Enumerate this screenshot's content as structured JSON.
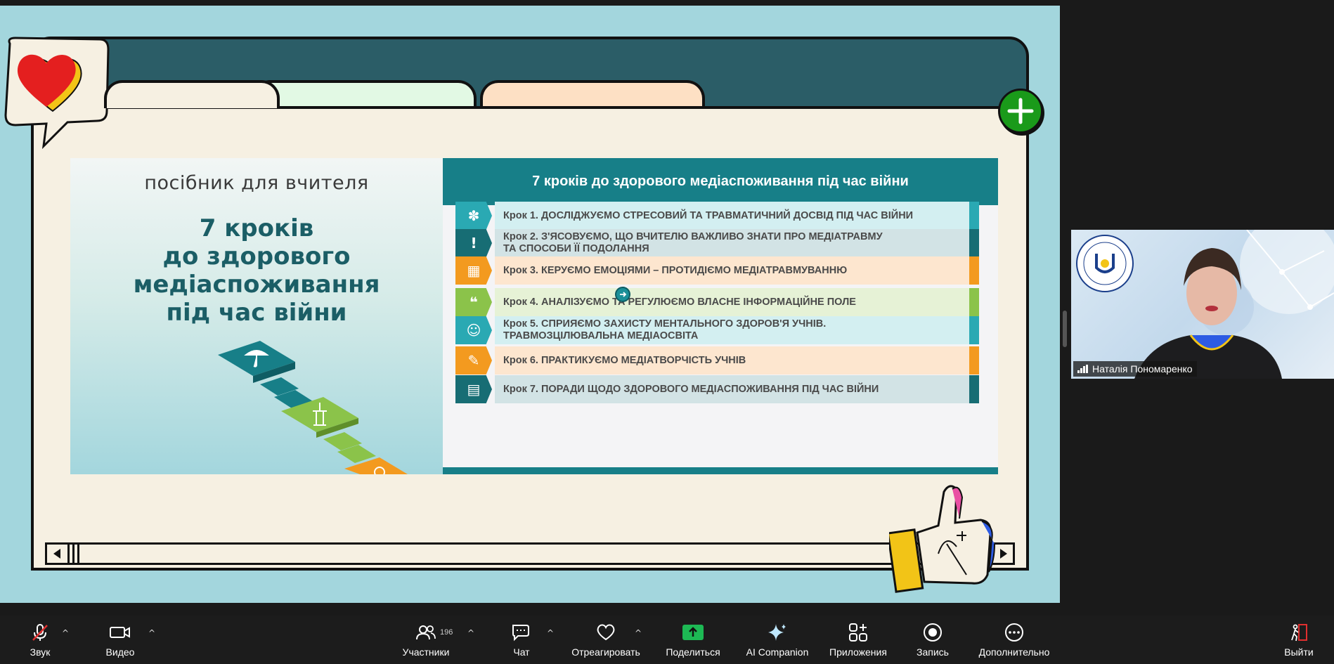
{
  "slide": {
    "guide_label": "посібник для вчителя",
    "guide_title": "7 кроків\nдо здорового\nмедіаспоживання\nпід час війни",
    "table_title": "7 кроків до здорового медіаспоживання під час війни",
    "steps": [
      {
        "text": "Крок 1. ДОСЛІДЖУЄМО СТРЕСОВИЙ ТА ТРАВМАТИЧНИЙ ДОСВІД ПІД ЧАС ВІЙНИ",
        "color": "#2aa9b3",
        "bg": "#d3eff1",
        "icon": "puzzle-head-icon"
      },
      {
        "text": "Крок 2. З'ЯСОВУЄМО, ЩО ВЧИТЕЛЮ ВАЖЛИВО ЗНАТИ ПРО МЕДІАТРАВМУ\nТА СПОСОБИ ЇЇ ПОДОЛАННЯ",
        "color": "#176d74",
        "bg": "#d2e3e5",
        "icon": "warning-head-icon"
      },
      {
        "text": "Крок 3. КЕРУЄМО ЕМОЦІЯМИ – ПРОТИДІЄМО МЕДІАТРАВМУВАННЮ",
        "color": "#f39a1f",
        "bg": "#fde6cf",
        "icon": "palette-grid-icon"
      },
      {
        "text": "Крок 4. АНАЛІЗУЄМО ТА РЕГУЛЮЄМО ВЛАСНЕ ІНФОРМАЦІЙНЕ ПОЛЕ",
        "color": "#8bc34a",
        "bg": "#e6f2d6",
        "icon": "chat-bubbles-icon"
      },
      {
        "text": "Крок 5. СПРИЯЄМО ЗАХИСТУ МЕНТАЛЬНОГО ЗДОРОВ'Я УЧНІВ.\nТРАВМОЗЦІЛЮВАЛЬНА МЕДІАОСВІТА",
        "color": "#2aa9b3",
        "bg": "#d3eff1",
        "icon": "brain-head-icon"
      },
      {
        "text": "Крок 6. ПРАКТИКУЄМО МЕДІАТВОРЧІСТЬ УЧНІВ",
        "color": "#f39a1f",
        "bg": "#fde6cf",
        "icon": "paint-palette-icon"
      },
      {
        "text": "Крок 7. ПОРАДИ ЩОДО ЗДОРОВОГО МЕДІАСПОЖИВАННЯ ПІД ЧАС ВІЙНИ",
        "color": "#176d74",
        "bg": "#d2e3e5",
        "icon": "calendar-icon"
      }
    ]
  },
  "participant": {
    "name": "Наталія Пономаренко"
  },
  "toolbar": {
    "audio": "Звук",
    "video": "Видео",
    "participants": "Участники",
    "participants_count": "196",
    "chat": "Чат",
    "react": "Отреагировать",
    "share": "Поделиться",
    "ai": "AI Companion",
    "apps": "Приложения",
    "record": "Запись",
    "more": "Дополнительно",
    "leave": "Выйти"
  },
  "colors": {
    "stage_bg": "#a3d6dd",
    "share_green": "#1db954",
    "leave_red": "#e02f2f"
  }
}
